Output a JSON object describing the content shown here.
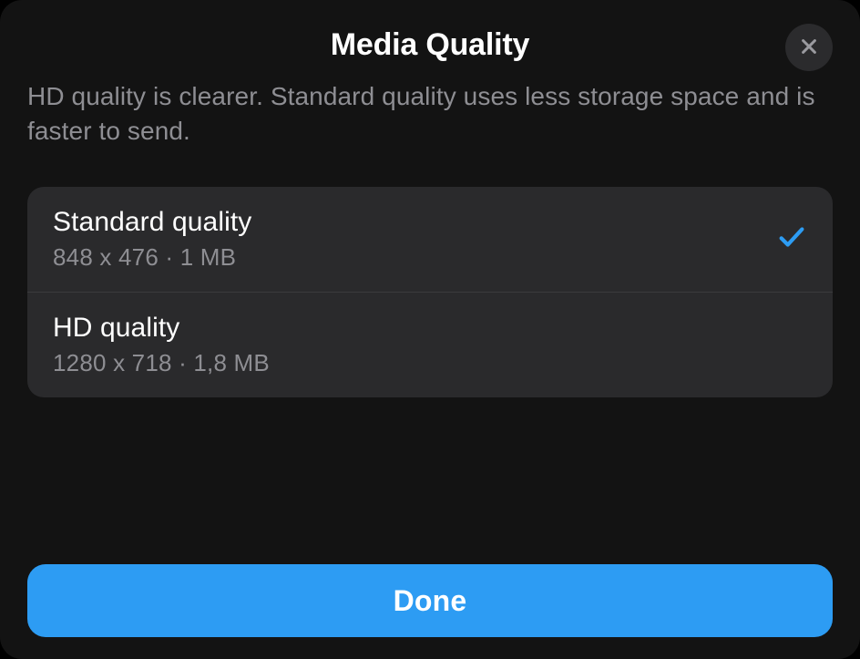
{
  "header": {
    "title": "Media Quality"
  },
  "description": "HD quality is clearer. Standard quality uses less storage space and is faster to send.",
  "options": [
    {
      "label": "Standard quality",
      "detail": "848 x 476 · 1 MB",
      "selected": true
    },
    {
      "label": "HD quality",
      "detail": "1280 x 718 · 1,8 MB",
      "selected": false
    }
  ],
  "done_label": "Done"
}
